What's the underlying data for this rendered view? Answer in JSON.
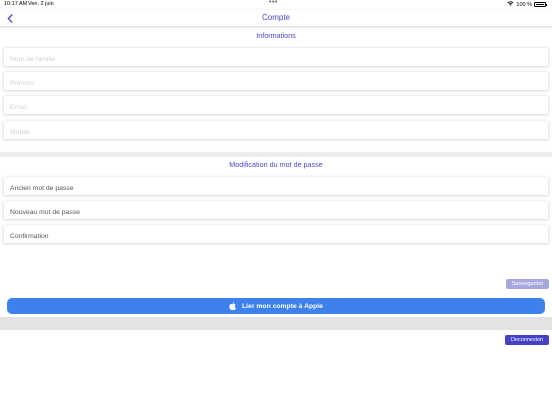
{
  "status_bar": {
    "time": "10:17 AM",
    "date": "Ven. 2 juin",
    "dots": "•••",
    "wifi_icon": "wifi-icon",
    "battery_percent": "100 %",
    "battery_level": 1.0
  },
  "header": {
    "back_icon": "chevron-left-icon",
    "title": "Compte"
  },
  "informations": {
    "title": "Informations",
    "fields": [
      {
        "placeholder": "Nom de famille",
        "value": ""
      },
      {
        "placeholder": "Prénom",
        "value": ""
      },
      {
        "placeholder": "Email",
        "value": ""
      },
      {
        "placeholder": "Mobile",
        "value": ""
      }
    ]
  },
  "password": {
    "title": "Modification du mot de passe",
    "fields": [
      {
        "placeholder": "Ancien mot de passe",
        "value": ""
      },
      {
        "placeholder": "Nouveau mot de passe",
        "value": ""
      },
      {
        "placeholder": "Confirmation",
        "value": ""
      }
    ],
    "save_label": "Sauvegarder"
  },
  "apple": {
    "label": "Lier mon compte à Apple",
    "icon": "apple-icon",
    "color": "#3d82ec"
  },
  "logout_label": "Deconnexion",
  "colors": {
    "accent": "#4a48c9",
    "save_disabled": "#a9a8de",
    "logout": "#4441c4"
  }
}
